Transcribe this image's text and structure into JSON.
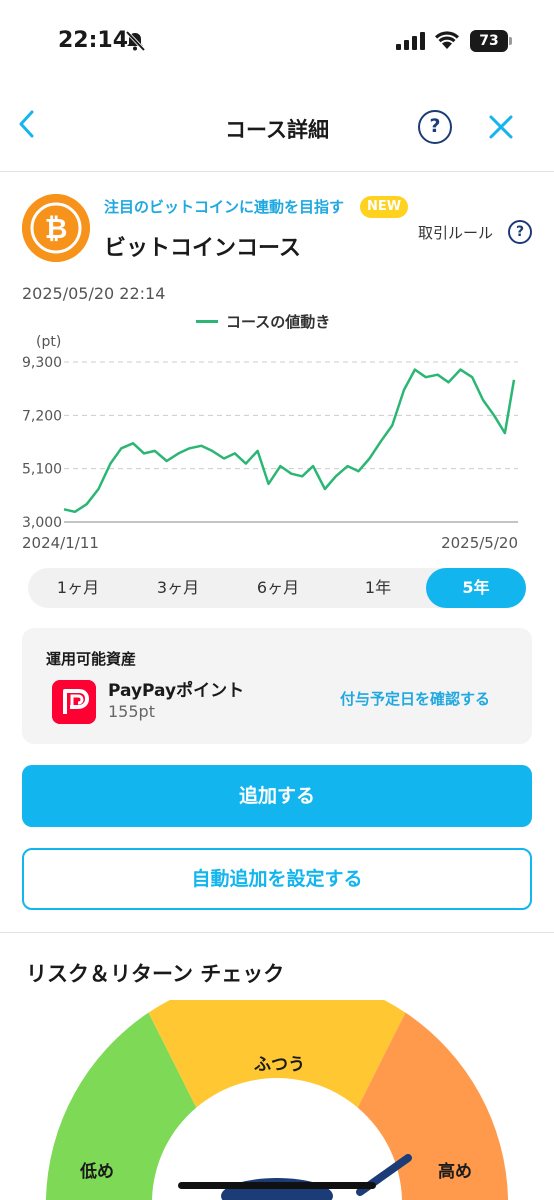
{
  "status_bar": {
    "time": "22:14",
    "battery_level": "73",
    "icons": [
      "bell-slash-icon",
      "cellular-signal-icon",
      "wifi-icon",
      "battery-icon"
    ]
  },
  "nav": {
    "title": "コース詳細",
    "help_symbol": "?",
    "icons": [
      "chevron-left-icon",
      "help-icon",
      "close-icon"
    ]
  },
  "course": {
    "tagline": "注目のビットコインに連動を目指す",
    "badge": "NEW",
    "name": "ビットコインコース",
    "rules_label": "取引ルール",
    "rules_help_symbol": "?",
    "icon": "bitcoin-icon",
    "icon_color": "#f7931a"
  },
  "chart_header": {
    "timestamp": "2025/05/20 22:14"
  },
  "chart_data": {
    "type": "line",
    "ylabel": "(pt)",
    "ylim": [
      3000,
      9300
    ],
    "yticks": [
      "9,300",
      "7,200",
      "5,100",
      "3,000"
    ],
    "ytick_values": [
      9300,
      7200,
      5100,
      3000
    ],
    "x_start_label": "2024/1/11",
    "x_end_label": "2025/5/20",
    "grid": "dashed horizontal",
    "series": [
      {
        "name": "コースの値動き",
        "color": "#2bb673",
        "x": [
          "2024-01-11",
          "2024-01-23",
          "2024-02-05",
          "2024-02-18",
          "2024-03-02",
          "2024-03-14",
          "2024-03-27",
          "2024-04-08",
          "2024-04-20",
          "2024-05-03",
          "2024-05-16",
          "2024-05-28",
          "2024-06-10",
          "2024-06-22",
          "2024-07-05",
          "2024-07-17",
          "2024-07-29",
          "2024-08-11",
          "2024-08-23",
          "2024-09-05",
          "2024-09-17",
          "2024-09-29",
          "2024-10-11",
          "2024-10-24",
          "2024-11-05",
          "2024-11-18",
          "2024-11-30",
          "2024-12-12",
          "2024-12-25",
          "2025-01-06",
          "2025-01-19",
          "2025-01-31",
          "2025-02-12",
          "2025-02-25",
          "2025-03-09",
          "2025-03-22",
          "2025-04-04",
          "2025-04-16",
          "2025-04-28",
          "2025-05-10",
          "2025-05-20"
        ],
        "y": [
          3500,
          3400,
          3700,
          4300,
          5300,
          5900,
          6100,
          5700,
          5800,
          5400,
          5700,
          5900,
          6000,
          5800,
          5500,
          5700,
          5300,
          5800,
          4500,
          5200,
          4900,
          4800,
          5200,
          4300,
          4800,
          5200,
          5000,
          5500,
          6200,
          6800,
          8200,
          9000,
          8700,
          8800,
          8500,
          9000,
          8700,
          7800,
          7200,
          6500,
          8600
        ]
      }
    ]
  },
  "range_tabs": {
    "items": [
      "1ヶ月",
      "3ヶ月",
      "6ヶ月",
      "1年",
      "5年"
    ],
    "selected": "5年"
  },
  "assets": {
    "heading": "運用可能資産",
    "name": "PayPayポイント",
    "amount": "155pt",
    "link_label": "付与予定日を確認する",
    "icon": "paypay-icon",
    "icon_color": "#ff0033"
  },
  "actions": {
    "add_label": "追加する",
    "auto_label": "自動追加を設定する",
    "accent_color": "#13b5ef"
  },
  "risk": {
    "title": "リスク＆リターン チェック",
    "levels": [
      {
        "label": "低め",
        "color": "#7ed957"
      },
      {
        "label": "ふつう",
        "color": "#ffc832"
      },
      {
        "label": "高め",
        "color": "#ff9a4d"
      }
    ]
  }
}
